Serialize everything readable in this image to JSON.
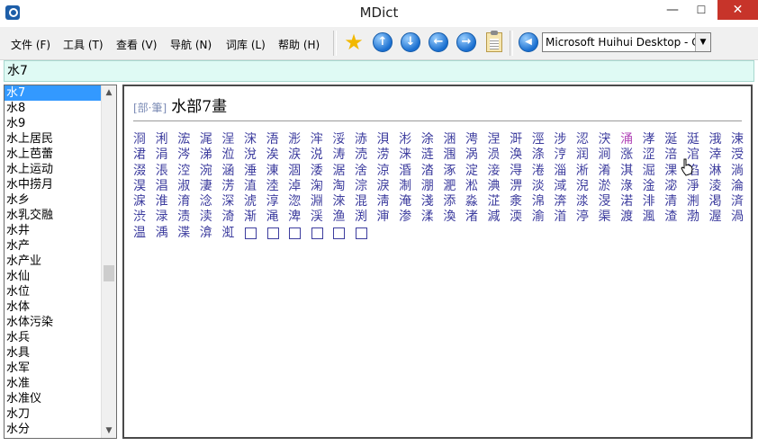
{
  "window": {
    "title": "MDict"
  },
  "menu": [
    {
      "label": "文件 (F)"
    },
    {
      "label": "工具 (T)"
    },
    {
      "label": "查看 (V)"
    },
    {
      "label": "导航 (N)"
    },
    {
      "label": "词库 (L)"
    },
    {
      "label": "帮助 (H)"
    }
  ],
  "toolbar": {
    "up_glyph": "↑",
    "down_glyph": "↓",
    "back_glyph": "←",
    "forward_glyph": "→",
    "speak_glyph": "◀",
    "dictionary": "Microsoft Huihui Desktop - C"
  },
  "search": {
    "value": "水7"
  },
  "wordlist": {
    "selected_index": 0,
    "items": [
      "水7",
      "水8",
      "水9",
      "水上居民",
      "水上芭蕾",
      "水上运动",
      "水中捞月",
      "水乡",
      "水乳交融",
      "水井",
      "水产",
      "水产业",
      "水仙",
      "水位",
      "水体",
      "水体污染",
      "水兵",
      "水具",
      "水军",
      "水准",
      "水准仪",
      "水刀",
      "水分"
    ]
  },
  "entry": {
    "tag": "[部·筆]",
    "heading": "水部7畫",
    "visited_char": "涌",
    "rows": [
      "浻浰浤浘浧浨浯浵浶浽浾浿涁涂涃涄涅涆涇涉涊涋涌涍涎涏涐涑",
      "涒涓涔涕涖涗涘涙涚涛涜涝涞涟涠涡涢涣涤涥润涧涨涩涪涫涬涭涮涯",
      "涰涱涳涴涵涶涷涸涹涺涻涼涽涾涿淀淁淂淃淄淅淆淇淈淉淊淋淌淍淎",
      "淏淐淑淒淓淔淕淖淗淘淙淚淛淜淝淞淟淠淡淢淣淤淥淦淧淨淩淪淫淬",
      "淭淮淯淰深淲淳淴淵淶混淸淹淺添淼淽淾淿渀渁渂渃渄清渆渇済渉渊",
      "渋渌渍渎渏渐渑渒渓渔渕渖渗渘渙渚減渜渝渞渟渠渡渢渣渤渥渦渧渨",
      "温渪渫渰渱"
    ],
    "empty_boxes": 6
  }
}
